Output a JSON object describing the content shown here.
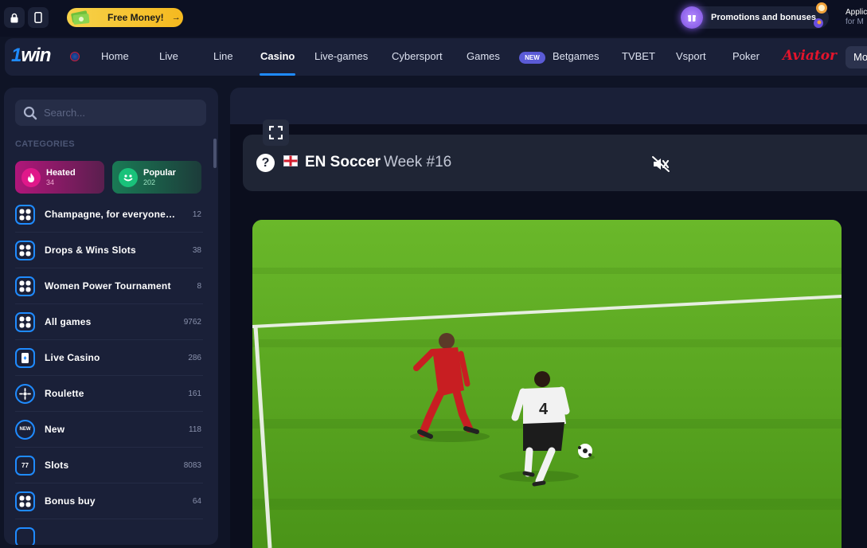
{
  "topbar": {
    "free_money_label": "Free Money!",
    "free_money_arrow": "→",
    "promo_label": "Promotions and bonuses",
    "app_title": "Applic",
    "app_sub": "for M",
    "icons": [
      "lock-icon",
      "phone-icon",
      "money-stack-icon",
      "gift-icon"
    ]
  },
  "nav": {
    "logo_one": "1",
    "logo_win": "win",
    "items": [
      {
        "label": "Home"
      },
      {
        "label": "Live"
      },
      {
        "label": "Line"
      },
      {
        "label": "Casino",
        "active": true
      },
      {
        "label": "Live-games"
      },
      {
        "label": "Cybersport"
      },
      {
        "label": "Games"
      },
      {
        "label": "Betgames",
        "badge": "NEW"
      },
      {
        "label": "TVBET"
      },
      {
        "label": "Vsport"
      },
      {
        "label": "Poker"
      }
    ],
    "new_badge": "NEW",
    "aviator": "Aviator",
    "more_label": "Mo"
  },
  "sidebar": {
    "search_placeholder": "Search...",
    "categories_title": "CATEGORIES",
    "pills": [
      {
        "label": "Heated",
        "count": "34",
        "icon": "fire-icon"
      },
      {
        "label": "Popular",
        "count": "202",
        "icon": "smile-icon"
      }
    ],
    "items": [
      {
        "label": "Champagne, for everyone! Drops & Wins",
        "count": "12",
        "icon": "grid-icon"
      },
      {
        "label": "Drops & Wins Slots",
        "count": "38",
        "icon": "grid-icon"
      },
      {
        "label": "Women Power Tournament",
        "count": "8",
        "icon": "grid-icon"
      },
      {
        "label": "All games",
        "count": "9762",
        "icon": "grid-icon"
      },
      {
        "label": "Live Casino",
        "count": "286",
        "icon": "cards-icon"
      },
      {
        "label": "Roulette",
        "count": "161",
        "icon": "roulette-icon"
      },
      {
        "label": "New",
        "count": "118",
        "icon": "new-icon"
      },
      {
        "label": "Slots",
        "count": "8083",
        "icon": "slots-icon"
      },
      {
        "label": "Bonus buy",
        "count": "64",
        "icon": "grid-icon"
      }
    ]
  },
  "game": {
    "title": "EN Soccer",
    "subtitle": "Week #16",
    "help": "?",
    "player_number": "4"
  },
  "colors": {
    "accent": "#1f8bff",
    "nav_bg": "#1a2038",
    "page_bg": "#0f1426",
    "free_money": "#f5c51f",
    "aviator_red": "#e4142c"
  }
}
